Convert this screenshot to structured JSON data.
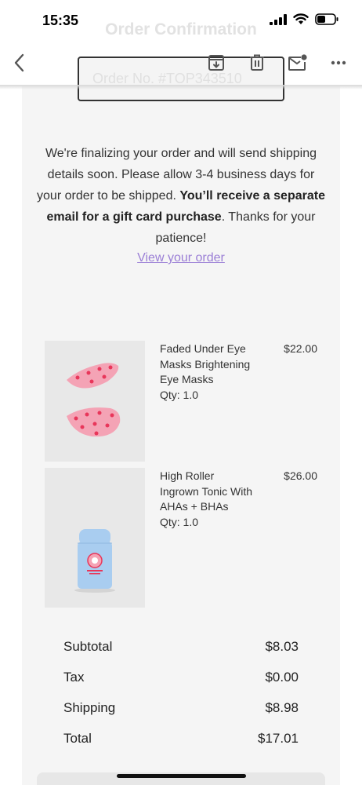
{
  "status_bar": {
    "time": "15:35"
  },
  "ghost_header": {
    "title": "Order Confirmation",
    "order_number": "Order No. #TOP343510"
  },
  "toolbar": {
    "icons": [
      "back-icon",
      "archive-icon",
      "trash-icon",
      "mark-unread-icon",
      "more-icon"
    ]
  },
  "message": {
    "part1": "We're finalizing your order and will send shipping details soon. Please allow 3-4 business days for your order to be shipped. ",
    "bold": "You’ll receive a separate email for a gift card purchase",
    "part2": ". Thanks for your patience!",
    "link": "View your order"
  },
  "products": [
    {
      "name": "Faded Under Eye Masks Brightening Eye Masks",
      "qty": "Qty: 1.0",
      "price": "$22.00"
    },
    {
      "name": "High Roller Ingrown Tonic With AHAs + BHAs",
      "qty": "Qty: 1.0",
      "price": "$26.00"
    }
  ],
  "summary": {
    "subtotal_label": "Subtotal",
    "subtotal": "$8.03",
    "tax_label": "Tax",
    "tax": "$0.00",
    "shipping_label": "Shipping",
    "shipping": "$8.98",
    "total_label": "Total",
    "total": "$17.01"
  },
  "colors": {
    "link": "#9b7fd6",
    "content_bg": "#f5f5f5",
    "mask_pink": "#f4a3b5",
    "bottle_blue": "#a9cdf0"
  }
}
